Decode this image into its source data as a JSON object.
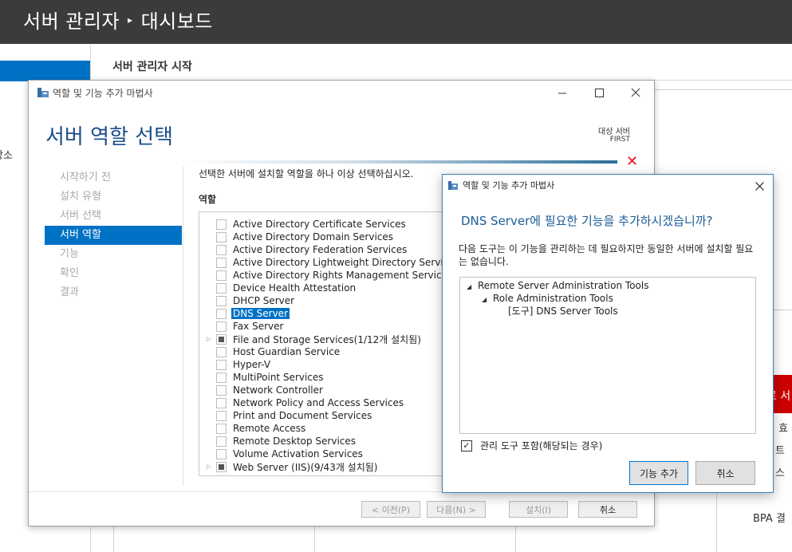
{
  "server_manager": {
    "title_part1": "서버 관리자",
    "title_part2": "대시보드",
    "heading": "서버 관리자 시작",
    "left_partial_item": "장소",
    "right_bg_text_1": "효",
    "right_bg_text_2": "트",
    "right_bg_text_3": "스",
    "right_bg_text_4": "BPA 결",
    "red_tile_text": "르 서"
  },
  "wizard": {
    "window_title": "역할 및 기능 추가 마법사",
    "heading": "서버 역할 선택",
    "destination_label": "대상 서버",
    "destination_server": "FIRST",
    "nav_items": [
      "시작하기 전",
      "설치 유형",
      "서버 선택",
      "서버 역할",
      "기능",
      "확인",
      "결과"
    ],
    "active_nav_index": 3,
    "description": "선택한 서버에 설치할 역할을 하나 이상 선택하십시오.",
    "roles_label": "역할",
    "roles": [
      {
        "name": "Active Directory Certificate Services",
        "expander": false,
        "state": "unchecked"
      },
      {
        "name": "Active Directory Domain Services",
        "expander": false,
        "state": "unchecked"
      },
      {
        "name": "Active Directory Federation Services",
        "expander": false,
        "state": "unchecked"
      },
      {
        "name": "Active Directory Lightweight Directory Services",
        "expander": false,
        "state": "unchecked"
      },
      {
        "name": "Active Directory Rights Management Services",
        "expander": false,
        "state": "unchecked"
      },
      {
        "name": "Device Health Attestation",
        "expander": false,
        "state": "unchecked"
      },
      {
        "name": "DHCP Server",
        "expander": false,
        "state": "unchecked"
      },
      {
        "name": "DNS Server",
        "expander": false,
        "state": "unchecked",
        "selected": true
      },
      {
        "name": "Fax Server",
        "expander": false,
        "state": "unchecked"
      },
      {
        "name": "File and Storage Services(1/12개 설치됨)",
        "expander": true,
        "state": "partial"
      },
      {
        "name": "Host Guardian Service",
        "expander": false,
        "state": "unchecked"
      },
      {
        "name": "Hyper-V",
        "expander": false,
        "state": "unchecked"
      },
      {
        "name": "MultiPoint Services",
        "expander": false,
        "state": "unchecked"
      },
      {
        "name": "Network Controller",
        "expander": false,
        "state": "unchecked"
      },
      {
        "name": "Network Policy and Access Services",
        "expander": false,
        "state": "unchecked"
      },
      {
        "name": "Print and Document Services",
        "expander": false,
        "state": "unchecked"
      },
      {
        "name": "Remote Access",
        "expander": false,
        "state": "unchecked"
      },
      {
        "name": "Remote Desktop Services",
        "expander": false,
        "state": "unchecked"
      },
      {
        "name": "Volume Activation Services",
        "expander": false,
        "state": "unchecked"
      },
      {
        "name": "Web Server (IIS)(9/43개 설치됨)",
        "expander": true,
        "state": "partial"
      }
    ],
    "buttons": {
      "previous": "< 이전(P)",
      "next": "다음(N) >",
      "install": "설치(I)",
      "cancel": "취소"
    }
  },
  "popup": {
    "window_title": "역할 및 기능 추가 마법사",
    "heading": "DNS Server에 필요한 기능을 추가하시겠습니까?",
    "body": "다음 도구는 이 기능을 관리하는 데 필요하지만 동일한 서버에 설치할 필요는 없습니다.",
    "tree": [
      {
        "label": "Remote Server Administration Tools",
        "level": 0,
        "arrow": "◢"
      },
      {
        "label": "Role Administration Tools",
        "level": 1,
        "arrow": "◢"
      },
      {
        "label": "[도구] DNS Server Tools",
        "level": 2,
        "arrow": ""
      }
    ],
    "include_tools_label": "관리 도구 포함(해당되는 경우)",
    "include_tools_checked": true,
    "add_features_button": "기능 추가",
    "cancel_button": "취소"
  }
}
